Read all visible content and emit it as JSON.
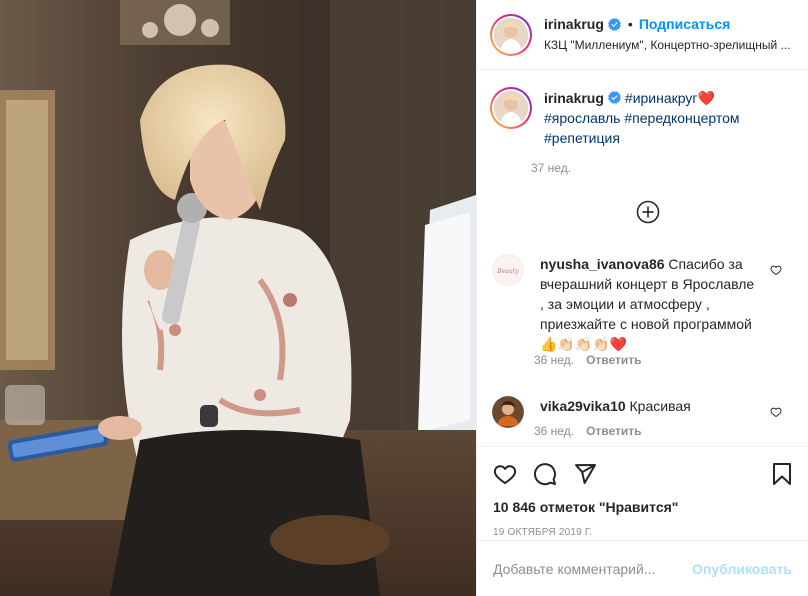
{
  "post": {
    "author": {
      "username": "irinakrug",
      "verified": true,
      "follow_label": "Подписаться",
      "separator": "•",
      "location": "КЗЦ \"Миллениум\", Концертно-зрелищный ..."
    },
    "caption": {
      "username": "irinakrug",
      "hashtags": [
        "#иринакруг",
        "#ярославль",
        "#передконцертом",
        "#репетиция"
      ],
      "emoji": "❤️",
      "time": "37 нед."
    },
    "load_more_icon": "plus-circle-icon",
    "comments": [
      {
        "username": "nyusha_ivanova86",
        "text": "Спасибо за вчерашний концерт в Ярославле , за эмоции и атмосферу , приезжайте с новой программой",
        "emoji": "👍👏🏻👏🏻👏🏻❤️",
        "time": "36 нед.",
        "reply_label": "Ответить"
      },
      {
        "username": "vika29vika10",
        "text": "Красивая",
        "time": "36 нед.",
        "reply_label": "Ответить"
      }
    ],
    "actions": {
      "icons": [
        "heart-icon",
        "comment-icon",
        "share-icon",
        "bookmark-icon"
      ]
    },
    "likes_text": "10 846 отметок \"Нравится\"",
    "date": "19 ОКТЯБРЯ 2019 Г.",
    "add_comment": {
      "placeholder": "Добавьте комментарий...",
      "publish_label": "Опубликовать"
    },
    "colors": {
      "link_blue": "#0095f6",
      "hashtag": "#00376b",
      "muted": "#8e8e8e",
      "publish_disabled": "#b2dffc",
      "heart_red": "#ed4956"
    }
  }
}
